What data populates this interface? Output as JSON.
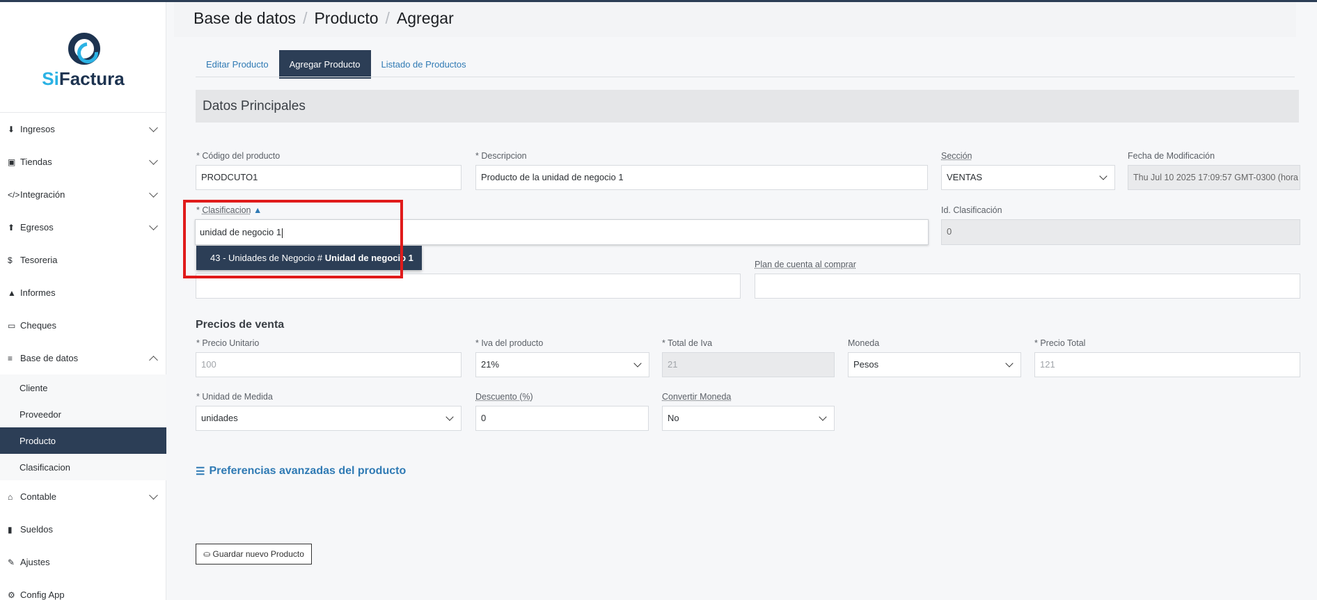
{
  "logo": {
    "part1": "Si",
    "part2": "Factura"
  },
  "sidebar": {
    "items": [
      {
        "icon": "download-icon",
        "glyph": "⬇",
        "label": "Ingresos"
      },
      {
        "icon": "store-icon",
        "glyph": "▣",
        "label": "Tiendas"
      },
      {
        "icon": "code-icon",
        "glyph": "</>",
        "label": "Integración"
      },
      {
        "icon": "upload-icon",
        "glyph": "⬆",
        "label": "Egresos"
      },
      {
        "icon": "dollar-icon",
        "glyph": "$",
        "label": "Tesoreria"
      },
      {
        "icon": "chart-icon",
        "glyph": "▲",
        "label": "Informes"
      },
      {
        "icon": "card-icon",
        "glyph": "▭",
        "label": "Cheques"
      },
      {
        "icon": "database-icon",
        "glyph": "≡",
        "label": "Base de datos"
      }
    ],
    "subitems": [
      "Cliente",
      "Proveedor",
      "Producto",
      "Clasificacion"
    ],
    "items_after": [
      {
        "icon": "bank-icon",
        "glyph": "⌂",
        "label": "Contable"
      },
      {
        "icon": "book-icon",
        "glyph": "▮",
        "label": "Sueldos"
      },
      {
        "icon": "wrench-icon",
        "glyph": "✎",
        "label": "Ajustes"
      },
      {
        "icon": "gears-icon",
        "glyph": "⚙",
        "label": "Config App"
      }
    ]
  },
  "breadcrumb": {
    "c1": "Base de datos",
    "c2": "Producto",
    "c3": "Agregar",
    "sep": "/"
  },
  "tabs": {
    "t1": "Editar Producto",
    "t2": "Agregar Producto",
    "t3": "Listado de Productos"
  },
  "section_title": "Datos Principales",
  "form": {
    "codigo_label": "* Código del producto",
    "codigo_value": "PRODCUTO1",
    "descripcion_label": "* Descripcion",
    "descripcion_value": "Producto de la unidad de negocio 1",
    "seccion_label": "Sección",
    "seccion_value": "VENTAS",
    "fecha_label": "Fecha de Modificación",
    "fecha_value": "Thu Jul 10 2025 17:09:57 GMT-0300 (hora",
    "clasificacion_label": "Clasificacion",
    "clasificacion_prefix": "* ",
    "clasificacion_value": "unidad de negocio 1",
    "idclas_label": "Id. Clasificación",
    "idclas_value": "0",
    "plan_label": "Plan de cuenta al comprar",
    "dropdown_prefix": "43 - Unidades de Negocio # ",
    "dropdown_bold": "Unidad de negocio 1"
  },
  "precios": {
    "title": "Precios de venta",
    "pu_label": "* Precio Unitario",
    "pu_value": "100",
    "iva_label": "* Iva del producto",
    "iva_value": "21%",
    "total_iva_label": "* Total de Iva",
    "total_iva_value": "21",
    "moneda_label": "Moneda",
    "moneda_value": "Pesos",
    "pt_label": "* Precio Total",
    "pt_value": "121",
    "um_label": "* Unidad de Medida",
    "um_value": "unidades",
    "desc_label": "Descuento (%)",
    "desc_value": "0",
    "conv_label": "Convertir Moneda",
    "conv_value": "No"
  },
  "advanced": {
    "label": "Preferencias avanzadas del producto"
  },
  "save_button": "⛀ Guardar nuevo Producto"
}
